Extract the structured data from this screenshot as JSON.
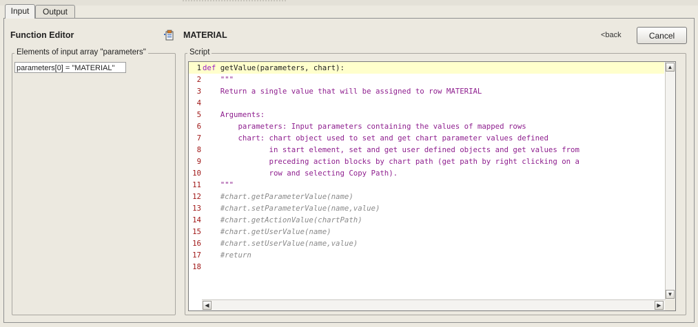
{
  "tabs": [
    {
      "label": "Input",
      "active": true
    },
    {
      "label": "Output",
      "active": false
    }
  ],
  "header": {
    "title": "Function Editor",
    "function_name": "MATERIAL",
    "back_label": "<back",
    "cancel_label": "Cancel"
  },
  "left_panel": {
    "legend": "Elements of input array \"parameters\"",
    "items": [
      "parameters[0] = \"MATERIAL\""
    ]
  },
  "script_panel": {
    "legend": "Script",
    "current_line": 1,
    "lines": [
      {
        "n": "1",
        "text": "def getValue(parameters, chart):",
        "type": "def"
      },
      {
        "n": "2",
        "text": "    \"\"\"",
        "type": "str"
      },
      {
        "n": "3",
        "text": "    Return a single value that will be assigned to row MATERIAL",
        "type": "str"
      },
      {
        "n": "4",
        "text": "",
        "type": "str"
      },
      {
        "n": "5",
        "text": "    Arguments:",
        "type": "str"
      },
      {
        "n": "6",
        "text": "        parameters: Input parameters containing the values of mapped rows",
        "type": "str"
      },
      {
        "n": "7",
        "text": "        chart: chart object used to set and get chart parameter values defined",
        "type": "str"
      },
      {
        "n": "8",
        "text": "               in start element, set and get user defined objects and get values from",
        "type": "str"
      },
      {
        "n": "9",
        "text": "               preceding action blocks by chart path (get path by right clicking on a",
        "type": "str"
      },
      {
        "n": "10",
        "text": "               row and selecting Copy Path).",
        "type": "str"
      },
      {
        "n": "11",
        "text": "    \"\"\"",
        "type": "str"
      },
      {
        "n": "12",
        "text": "    #chart.getParameterValue(name)",
        "type": "cmt"
      },
      {
        "n": "13",
        "text": "    #chart.setParameterValue(name,value)",
        "type": "cmt"
      },
      {
        "n": "14",
        "text": "    #chart.getActionValue(chartPath)",
        "type": "cmt"
      },
      {
        "n": "15",
        "text": "    #chart.getUserValue(name)",
        "type": "cmt"
      },
      {
        "n": "16",
        "text": "    #chart.setUserValue(name,value)",
        "type": "cmt"
      },
      {
        "n": "17",
        "text": "    #return",
        "type": "cmt"
      },
      {
        "n": "18",
        "text": "",
        "type": "plain"
      }
    ]
  },
  "colors": {
    "keyword": "#9A1FC2",
    "docstring": "#8E1E8E",
    "comment": "#8A8A8A",
    "line_number": "#A01818",
    "current_line_bg": "#FFFFCC"
  },
  "icons": {
    "function_icon": "clipboard-icon",
    "scroll_up": "arrow-up-icon",
    "scroll_down": "arrow-down-icon",
    "scroll_left": "arrow-left-icon",
    "scroll_right": "arrow-right-icon"
  }
}
